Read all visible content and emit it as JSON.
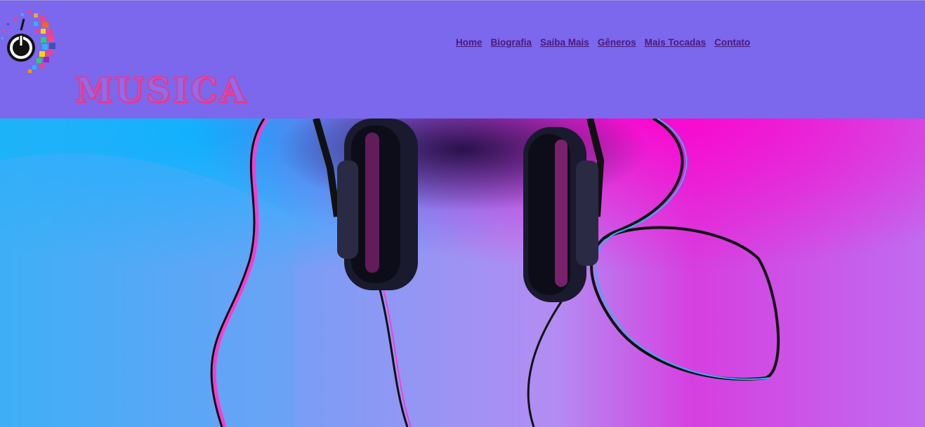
{
  "header": {
    "brand_title": "MUSICA",
    "logo_icon": "headphones-power-logo-icon"
  },
  "nav": {
    "items": [
      {
        "label": "Home"
      },
      {
        "label": "Biografia"
      },
      {
        "label": "Saiba Mais"
      },
      {
        "label": "Gêneros"
      },
      {
        "label": "Mais Tocadas"
      },
      {
        "label": "Contato"
      }
    ]
  },
  "hero": {
    "image": "headphones-neon-photo",
    "colors": {
      "cyan": "#29b6f6",
      "magenta": "#e01ad6",
      "violet": "#a78bfa"
    }
  },
  "theme": {
    "header_bg": "#7b68ec",
    "nav_link": "#4a1a7c",
    "brand_fill": "#8a6ff0",
    "brand_stroke": "#e8388f"
  }
}
